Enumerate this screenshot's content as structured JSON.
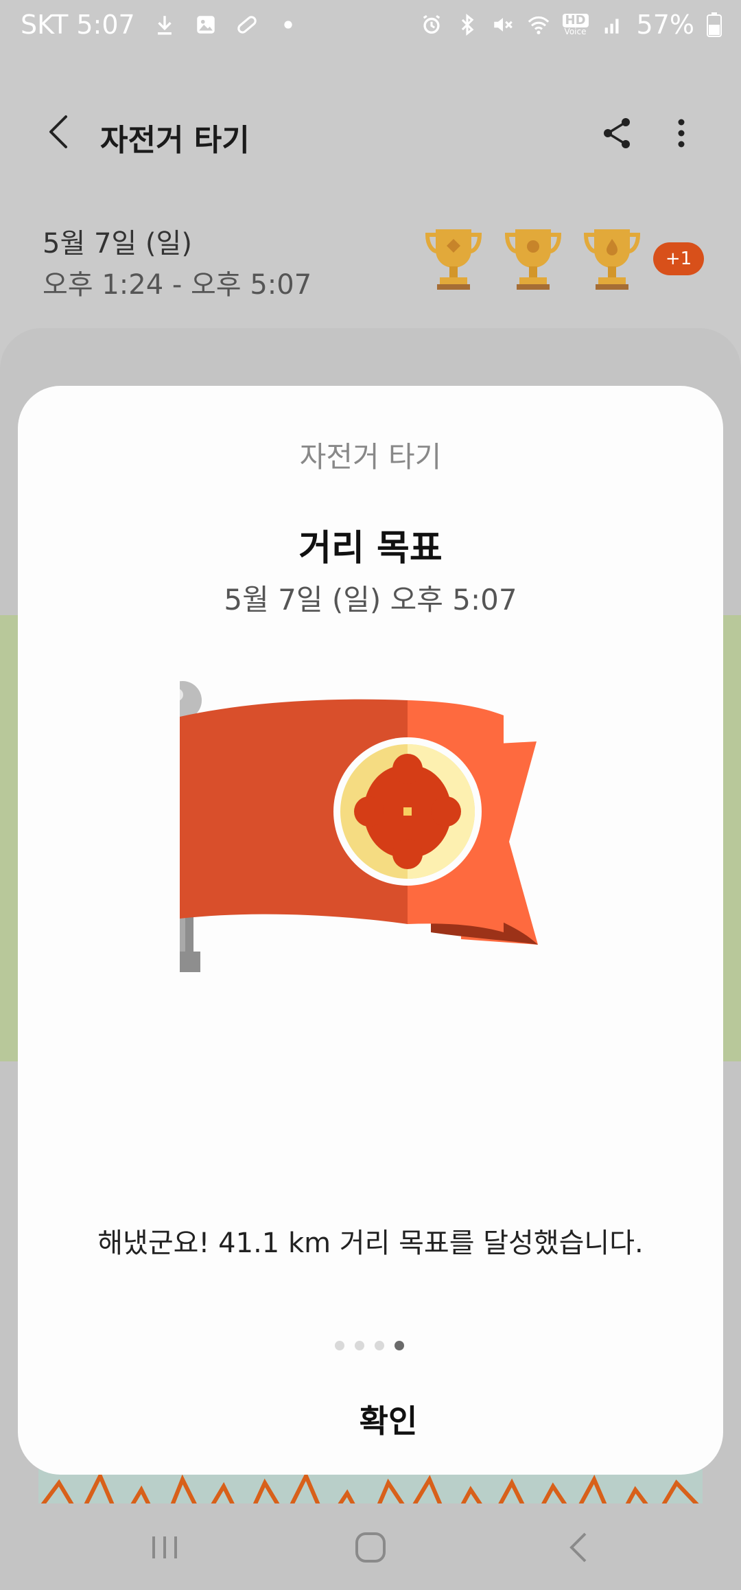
{
  "status_bar": {
    "carrier_time": "SKT 5:07",
    "battery": "57%",
    "hd_label": "HD",
    "voice_label": "Voice",
    "left_icons": [
      "download-icon",
      "image-icon",
      "bandage-icon",
      "dot-icon"
    ],
    "right_icons": [
      "alarm-icon",
      "bluetooth-icon",
      "mute-icon",
      "wifi-icon",
      "hd-voice-icon",
      "signal-icon",
      "battery-icon"
    ]
  },
  "header": {
    "title": "자전거 타기"
  },
  "workout": {
    "date": "5월 7일 (일)",
    "time_range": "오후 1:24 - 오후 5:07",
    "badges_more": "+1"
  },
  "dialog": {
    "app_name": "자전거 타기",
    "title": "거리 목표",
    "timestamp": "5월 7일 (일) 오후 5:07",
    "message": "해냈군요! 41.1 km 거리 목표를 달성했습니다.",
    "confirm_label": "확인",
    "page_count": 4,
    "active_page": 4
  },
  "colors": {
    "accent": "#d8501a",
    "trophy": "#e2a93a",
    "flag_dark": "#d94f2b",
    "flag_light": "#fe6a3f",
    "medal_light": "#fdf0b0",
    "medal_dark": "#f5dc82",
    "medal_center": "#d53d16"
  }
}
